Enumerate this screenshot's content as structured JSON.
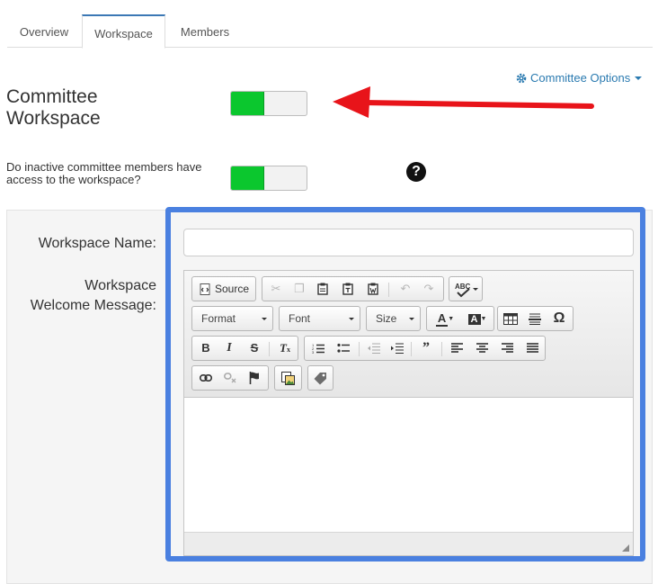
{
  "tabs": [
    "Overview",
    "Workspace",
    "Members"
  ],
  "options_link": "Committee Options",
  "workspace_toggle": {
    "label": "Committee Workspace",
    "state": "on"
  },
  "inactive_toggle": {
    "label": "Do inactive committee members have access to the workspace?",
    "state": "on"
  },
  "help_glyph": "?",
  "form": {
    "name_label": "Workspace Name:",
    "name_value": "",
    "welcome_label_line1": "Workspace",
    "welcome_label_line2": "Welcome Message:"
  },
  "editor": {
    "source_label": "Source",
    "format_label": "Format",
    "font_label": "Font",
    "size_label": "Size",
    "icons": {
      "row1": [
        "source-icon",
        "cut-icon",
        "copy-icon",
        "paste-icon",
        "paste-text-icon",
        "paste-word-icon",
        "undo-icon",
        "redo-icon",
        "spellcheck-icon"
      ],
      "row2": [
        "text-color-icon",
        "background-color-icon",
        "table-icon",
        "horizontal-line-icon",
        "special-char-icon"
      ],
      "row3": [
        "bold-icon",
        "italic-icon",
        "strike-icon",
        "remove-format-icon",
        "numbered-list-icon",
        "bulleted-list-icon",
        "outdent-icon",
        "indent-icon",
        "blockquote-icon",
        "align-left-icon",
        "align-center-icon",
        "align-right-icon",
        "justify-icon"
      ],
      "row4": [
        "link-icon",
        "unlink-icon",
        "anchor-icon",
        "image-icon",
        "tag-icon"
      ]
    },
    "content": ""
  },
  "colors": {
    "accent": "#2a7ab0",
    "toggle_on": "#0bc72e",
    "highlight": "#4a80e0",
    "arrow": "#e8141a"
  }
}
